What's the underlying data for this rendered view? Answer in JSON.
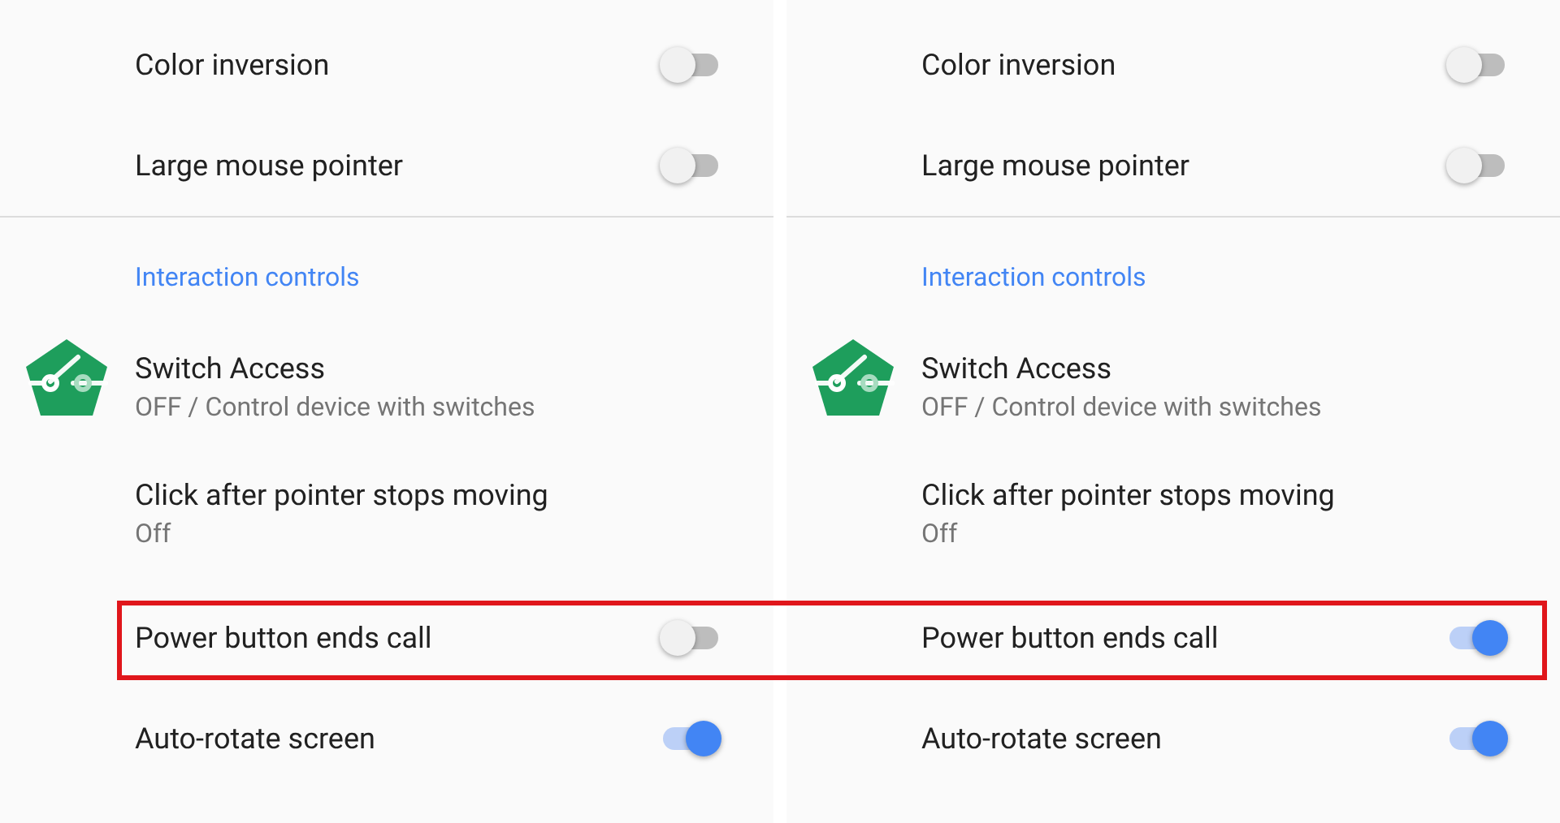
{
  "panels": [
    {
      "top_rows": [
        {
          "title": "Color inversion",
          "on": false
        },
        {
          "title": "Large mouse pointer",
          "on": false
        }
      ],
      "section": {
        "header": "Interaction controls",
        "rows": [
          {
            "kind": "app",
            "title": "Switch Access",
            "subtitle": "OFF / Control device with switches"
          },
          {
            "kind": "text",
            "title": "Click after pointer stops moving",
            "subtitle": "Off"
          },
          {
            "kind": "toggle",
            "title": "Power button ends call",
            "on": false
          },
          {
            "kind": "toggle",
            "title": "Auto-rotate screen",
            "on": true
          }
        ]
      }
    },
    {
      "top_rows": [
        {
          "title": "Color inversion",
          "on": false
        },
        {
          "title": "Large mouse pointer",
          "on": false
        }
      ],
      "section": {
        "header": "Interaction controls",
        "rows": [
          {
            "kind": "app",
            "title": "Switch Access",
            "subtitle": "OFF / Control device with switches"
          },
          {
            "kind": "text",
            "title": "Click after pointer stops moving",
            "subtitle": "Off"
          },
          {
            "kind": "toggle",
            "title": "Power button ends call",
            "on": true
          },
          {
            "kind": "toggle",
            "title": "Auto-rotate screen",
            "on": true
          }
        ]
      }
    }
  ]
}
